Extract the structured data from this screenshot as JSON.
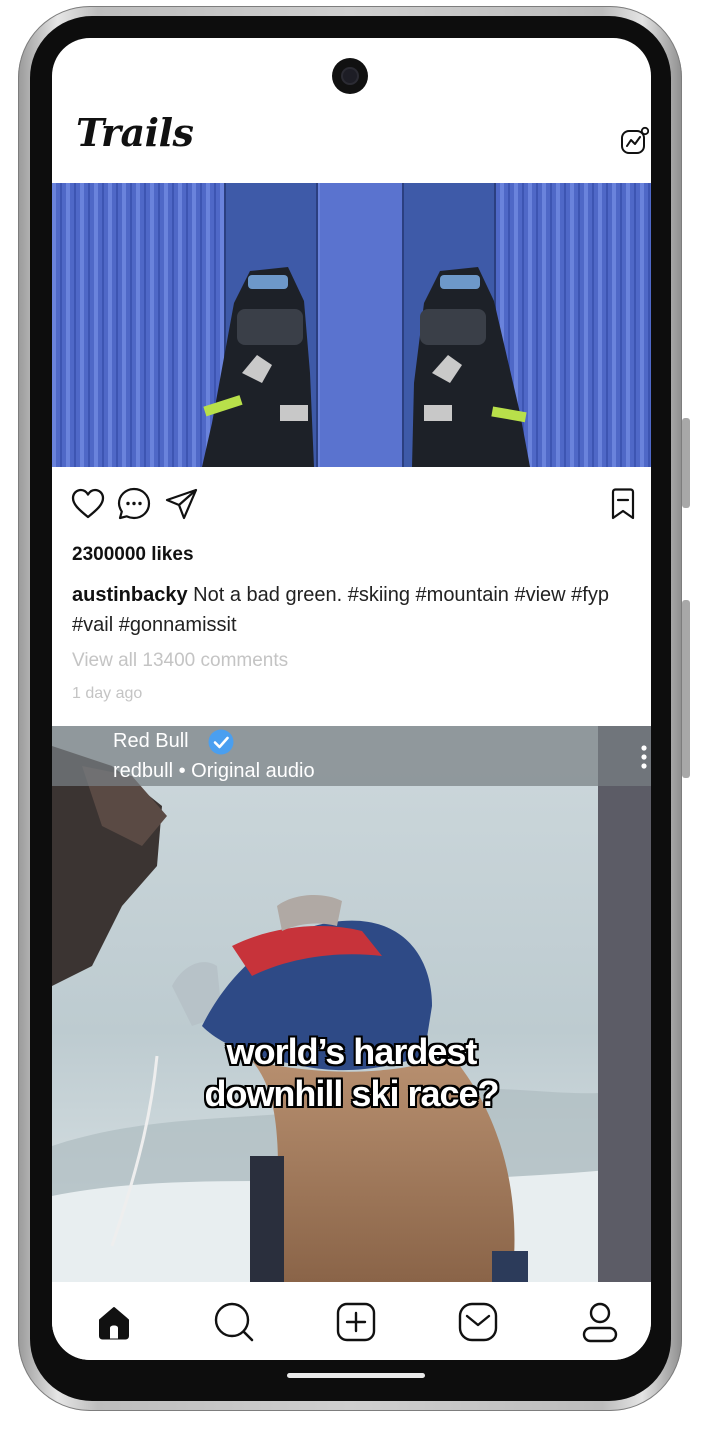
{
  "app": {
    "title": "Trails"
  },
  "post1": {
    "likes": "2300000 likes",
    "username": "austinbacky",
    "caption": " Not a bad green. #skiing #mountain #view #fyp #vail #gonnamissit",
    "view_comments": "View all 13400 comments",
    "time": "1 day ago"
  },
  "post2": {
    "account_name": "Red Bull",
    "audio_line": "redbull • Original audio",
    "overlay_line1": "world’s hardest",
    "overlay_line2": "downhill ski race?"
  },
  "icons": {
    "activity": "activity-chart-icon",
    "like": "heart-icon",
    "comment": "comment-icon",
    "share": "send-icon",
    "save": "bookmark-icon",
    "verified": "verified-badge-icon",
    "more": "more-vertical-icon",
    "tabs": [
      "home-icon",
      "search-icon",
      "create-icon",
      "messages-icon",
      "profile-icon"
    ]
  },
  "colors": {
    "verified": "#4a9ff0",
    "muted_text": "#c4c4c4",
    "text": "#111111"
  }
}
